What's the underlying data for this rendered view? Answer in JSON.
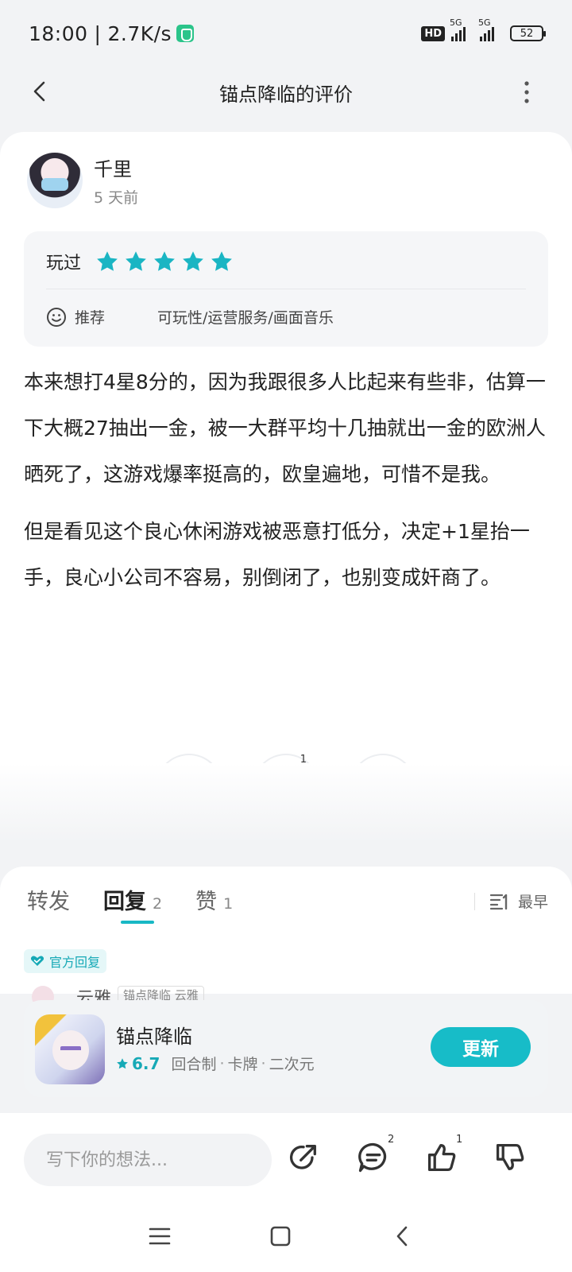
{
  "status_bar": {
    "time": "18:00",
    "network_speed": "2.7K/s",
    "hd_label": "HD",
    "signal_1_label": "5G",
    "signal_2_label": "5G",
    "battery": "52"
  },
  "header": {
    "title": "锚点降临的评价",
    "back_icon": "back-arrow",
    "more_icon": "vertical-ellipsis"
  },
  "review": {
    "author_name": "千里",
    "time_ago": "5 天前",
    "played_label": "玩过",
    "star_count": 5,
    "star_color": "#1ab5c3",
    "recommend_label": "推荐",
    "recommend_tags": "可玩性/运营服务/画面音乐",
    "paragraphs": [
      "本来想打4星8分的，因为我跟很多人比起来有些非，估算一下大概27抽出一金，被一大群平均十几抽就出一金的欧洲人晒死了，这游戏爆率挺高的，欧皇遍地，可惜不是我。",
      "但是看见这个良心休闲游戏被恶意打低分，决定+1星抬一手，良心小公司不容易，别倒闭了，也别变成奸商了。"
    ],
    "like_count": "1"
  },
  "reply_section": {
    "tabs": [
      {
        "label": "转发",
        "count": ""
      },
      {
        "label": "回复",
        "count": "2"
      },
      {
        "label": "赞",
        "count": "1"
      }
    ],
    "active_tab": "回复",
    "sort_label": "最早",
    "official_badge": "官方回复",
    "reply_preview_name": "云雅",
    "reply_preview_tag": "锚点降临 云雅"
  },
  "app_card": {
    "name": "锚点降临",
    "score": "6.7",
    "tags": [
      "回合制",
      "卡牌",
      "二次元"
    ],
    "button_label": "更新",
    "accent": "#17bcc8"
  },
  "bottom_bar": {
    "input_placeholder": "写下你的想法...",
    "comment_count": "2",
    "like_count": "1"
  }
}
